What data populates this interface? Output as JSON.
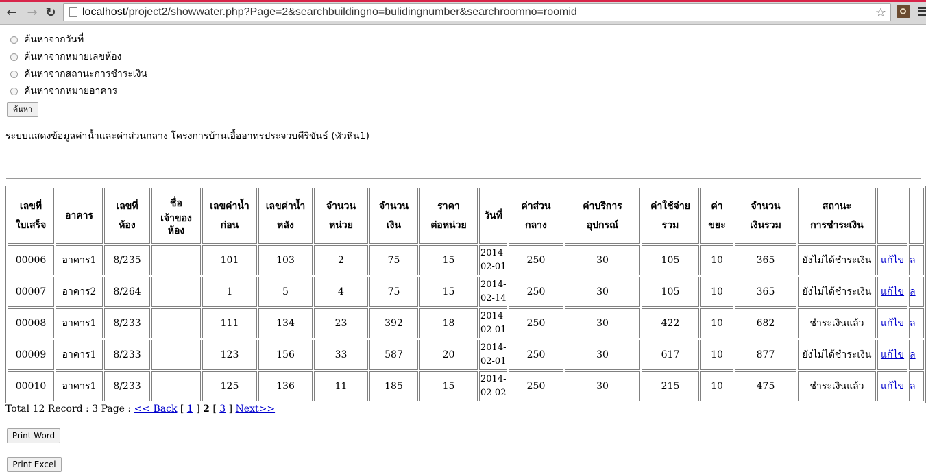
{
  "browser": {
    "url_host": "localhost",
    "url_rest": "/project2/showwater.php?Page=2&searchbuildingno=bulidingnumber&searchroomno=roomid",
    "back_icon": "back-arrow-icon",
    "forward_icon": "forward-arrow-icon",
    "reload_icon": "reload-icon"
  },
  "search": {
    "options": [
      "ค้นหาจากวันที่",
      "ค้นหาจากหมายเลขห้อง",
      "ค้นหาจากสถานะการชำระเงิน",
      "ค้นหาจากหมายอาคาร"
    ],
    "button_label": "ค้นหา"
  },
  "system_title": "ระบบแสดงข้อมูลค่าน้ำและค่าส่วนกลาง โครงการบ้านเอื้ออาทรประจวบคีรีขันธ์ (หัวหิน1)",
  "table": {
    "headers": [
      [
        "เลขที่",
        "ใบเสร็จ"
      ],
      [
        "อาคาร"
      ],
      [
        "เลขที่",
        "ห้อง"
      ],
      [
        "ชื่อ",
        "เจ้าของ",
        "ห้อง"
      ],
      [
        "เลขค่าน้ำ",
        "ก่อน"
      ],
      [
        "เลขค่าน้ำ",
        "หลัง"
      ],
      [
        "จำนวน",
        "หน่วย"
      ],
      [
        "จำนวน",
        "เงิน"
      ],
      [
        "ราคา",
        "ต่อหน่วย"
      ],
      [
        "วันที่"
      ],
      [
        "ค่าส่วน",
        "กลาง"
      ],
      [
        "ค่าบริการ",
        "อุปกรณ์"
      ],
      [
        "ค่าใช้จ่าย",
        "รวม"
      ],
      [
        "ค่า",
        "ขยะ"
      ],
      [
        "จำนวน",
        "เงินรวม"
      ],
      [
        "สถานะ",
        "การชำระเงิน"
      ]
    ],
    "edit_label": "แก้ไข",
    "delete_label_partial": "ล",
    "rows": [
      {
        "receipt": "00006",
        "building": "อาคาร1",
        "room": "8/235",
        "owner": "",
        "before": "101",
        "after": "103",
        "units": "2",
        "amount": "75",
        "price": "15",
        "date1": "2014-",
        "date2": "02-01",
        "common": "250",
        "service": "30",
        "total": "105",
        "garbage": "10",
        "grand": "365",
        "status": "ยังไม่ได้ชำระเงิน"
      },
      {
        "receipt": "00007",
        "building": "อาคาร2",
        "room": "8/264",
        "owner": "",
        "before": "1",
        "after": "5",
        "units": "4",
        "amount": "75",
        "price": "15",
        "date1": "2014-",
        "date2": "02-14",
        "common": "250",
        "service": "30",
        "total": "105",
        "garbage": "10",
        "grand": "365",
        "status": "ยังไม่ได้ชำระเงิน"
      },
      {
        "receipt": "00008",
        "building": "อาคาร1",
        "room": "8/233",
        "owner": "",
        "before": "111",
        "after": "134",
        "units": "23",
        "amount": "392",
        "price": "18",
        "date1": "2014-",
        "date2": "02-01",
        "common": "250",
        "service": "30",
        "total": "422",
        "garbage": "10",
        "grand": "682",
        "status": "ชำระเงินแล้ว"
      },
      {
        "receipt": "00009",
        "building": "อาคาร1",
        "room": "8/233",
        "owner": "",
        "before": "123",
        "after": "156",
        "units": "33",
        "amount": "587",
        "price": "20",
        "date1": "2014-",
        "date2": "02-01",
        "common": "250",
        "service": "30",
        "total": "617",
        "garbage": "10",
        "grand": "877",
        "status": "ยังไม่ได้ชำระเงิน"
      },
      {
        "receipt": "00010",
        "building": "อาคาร1",
        "room": "8/233",
        "owner": "",
        "before": "125",
        "after": "136",
        "units": "11",
        "amount": "185",
        "price": "15",
        "date1": "2014-",
        "date2": "02-02",
        "common": "250",
        "service": "30",
        "total": "215",
        "garbage": "10",
        "grand": "475",
        "status": "ชำระเงินแล้ว"
      }
    ]
  },
  "pager": {
    "summary": "Total 12 Record : 3 Page : ",
    "back": "<< Back",
    "page1": "1",
    "page2": "2",
    "page3": "3",
    "next": "Next>>"
  },
  "print_word": "Print Word",
  "print_excel": "Print Excel"
}
